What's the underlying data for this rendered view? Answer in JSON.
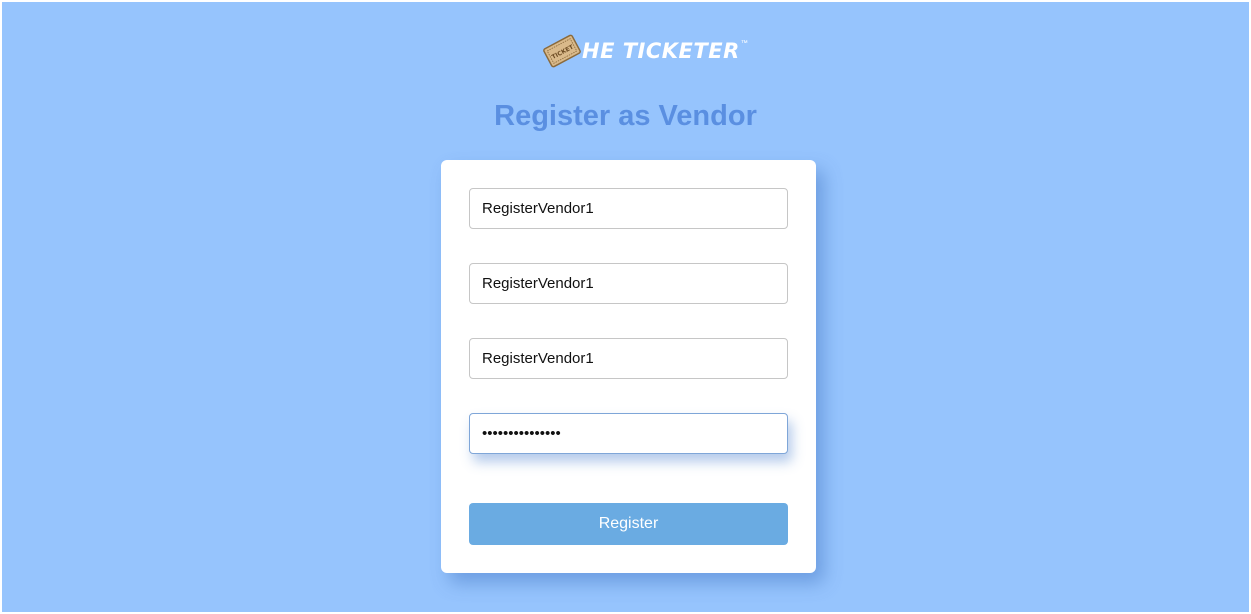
{
  "logo": {
    "text": "HE TICKETER",
    "tm": "™",
    "ticket_label": "TICKET"
  },
  "title": "Register as Vendor",
  "form": {
    "fields": [
      {
        "value": "RegisterVendor1",
        "type": "text"
      },
      {
        "value": "RegisterVendor1",
        "type": "text"
      },
      {
        "value": "RegisterVendor1",
        "type": "text"
      },
      {
        "value": "RegisterVendor1",
        "type": "password",
        "focused": true
      }
    ],
    "submit_label": "Register"
  },
  "colors": {
    "background": "#96c4fd",
    "title": "#5a8fe1",
    "button": "#6aabe2",
    "card": "#ffffff"
  }
}
